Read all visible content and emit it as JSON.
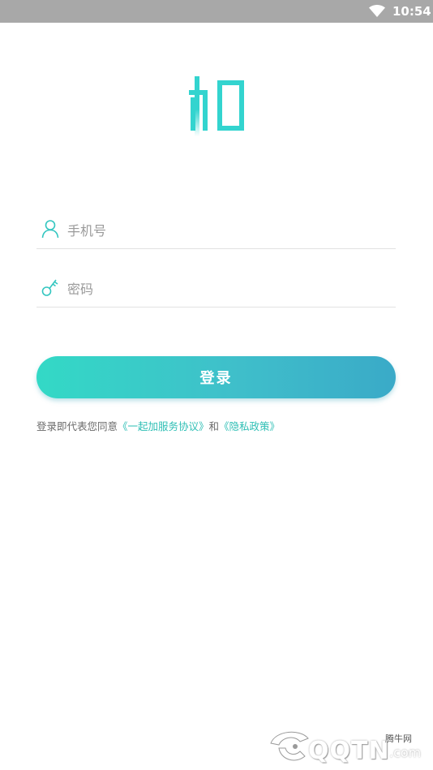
{
  "status_bar": {
    "time": "10:54",
    "icons": [
      "wifi-icon"
    ]
  },
  "logo": {
    "icon": "jia-logo-icon",
    "color": "#33d4cf"
  },
  "form": {
    "phone": {
      "placeholder": "手机号",
      "value": "",
      "icon": "user-icon"
    },
    "password": {
      "placeholder": "密码",
      "value": "",
      "icon": "key-icon"
    },
    "login_label": "登录"
  },
  "agreement": {
    "prefix": "登录即代表您同意",
    "service_link": "《一起加服务协议》",
    "conjunction": "和",
    "privacy_link": "《隐私政策》"
  },
  "watermark": {
    "brand": "QQTN",
    "suffix": ".com",
    "cn_name": "腾牛网"
  },
  "colors": {
    "accent": "#33d4cf",
    "gradient_start": "#33d9c6",
    "gradient_end": "#3aaac8",
    "status_bar": "#a8a8a8",
    "link": "#2fbfb5"
  }
}
